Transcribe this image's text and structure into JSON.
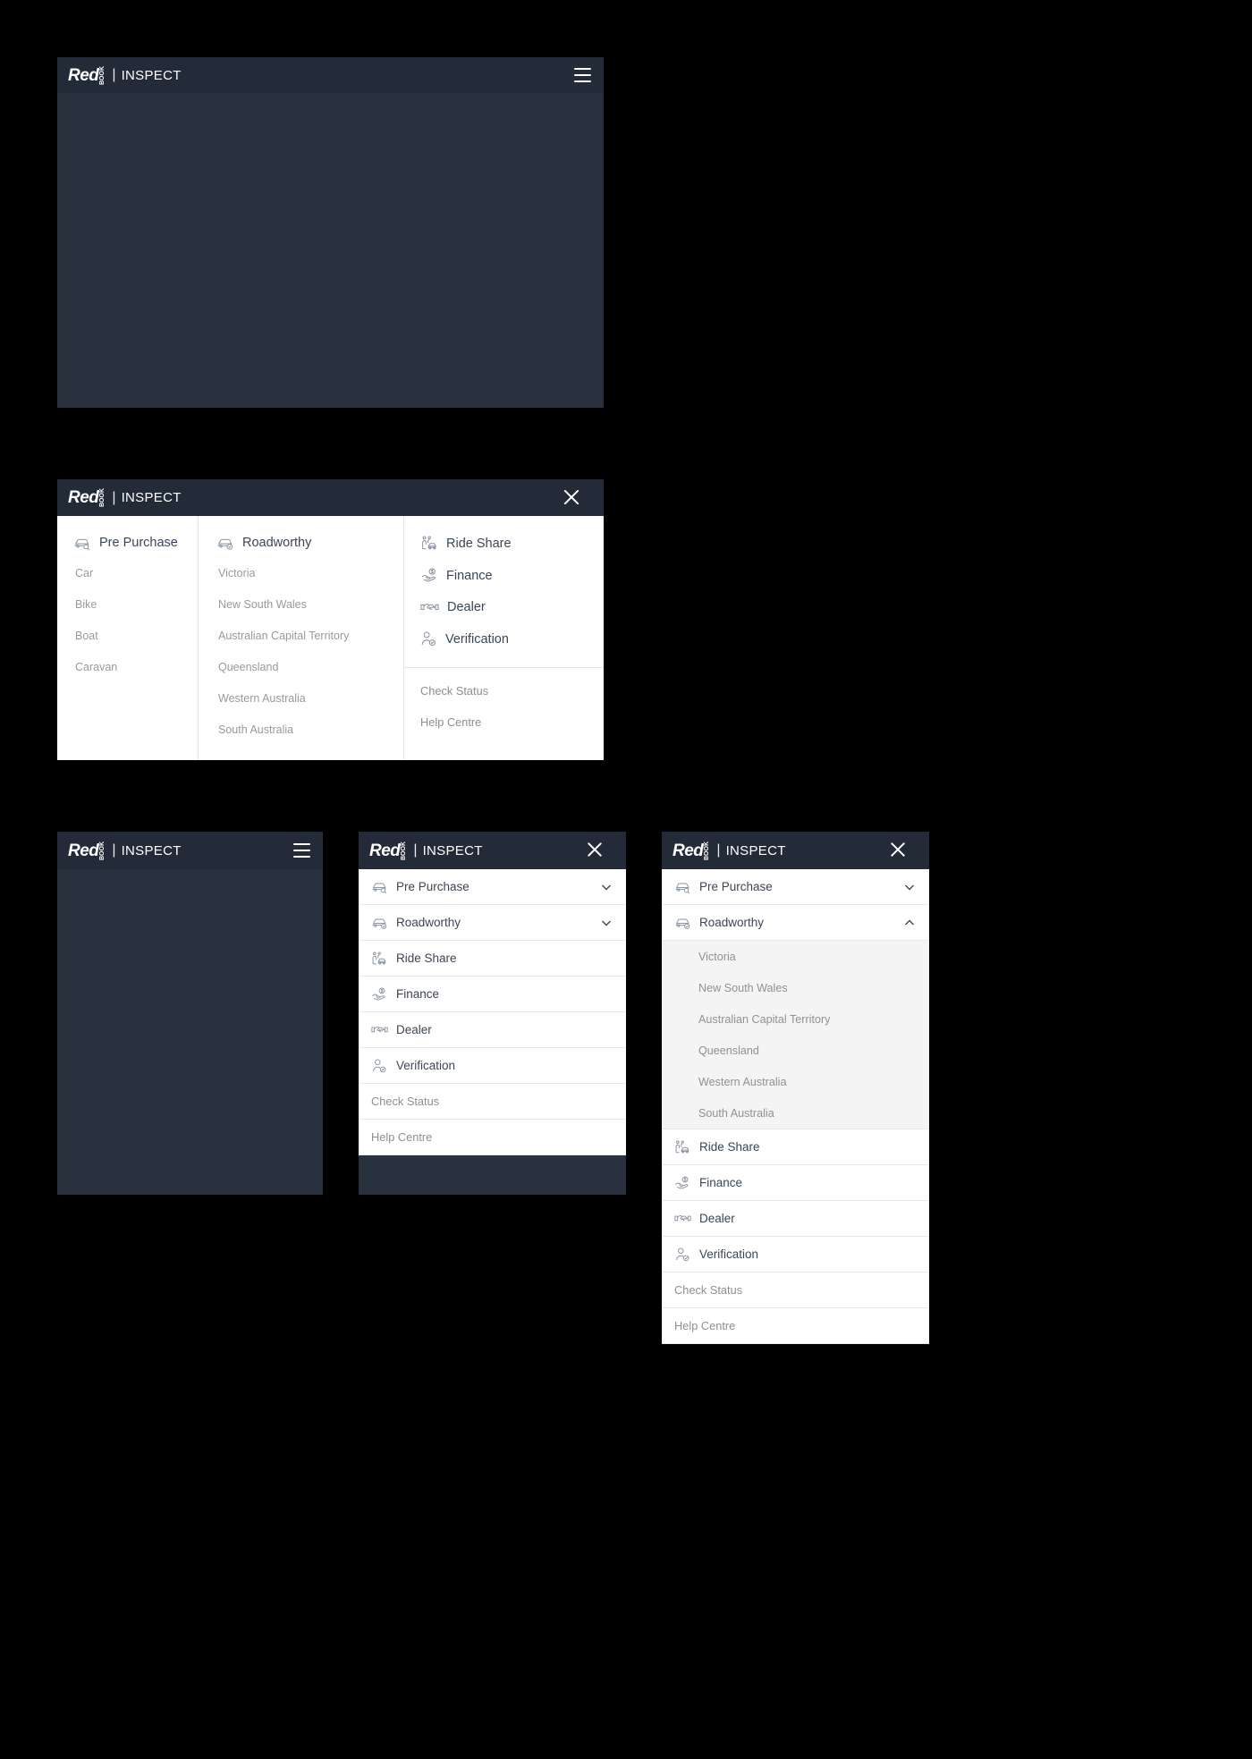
{
  "brand": {
    "red": "Red",
    "book": "BOOK",
    "separator": "|",
    "inspect": "INSPECT"
  },
  "colors": {
    "header_bg": "#242b38",
    "hero_bg": "#2a313e",
    "panel_bg": "#ffffff",
    "submenu_bg": "#f4f4f4",
    "primary_text": "#3b4559",
    "muted_text": "#9a9a9a",
    "divider": "#e6e6e6",
    "page_bg": "#000000"
  },
  "icons": {
    "hamburger": "hamburger-icon",
    "close": "close-icon",
    "chevron_down": "chevron-down-icon",
    "chevron_up": "chevron-up-icon",
    "pre_purchase": "car-inspect-icon",
    "roadworthy": "car-check-icon",
    "ride_share": "person-car-icon",
    "finance": "hand-dollar-icon",
    "dealer": "handshake-icon",
    "verification": "person-check-icon"
  },
  "mega_menu": {
    "columns": [
      {
        "name": "pre-purchase",
        "header": {
          "label": "Pre Purchase",
          "icon": "car-inspect-icon"
        },
        "items": [
          "Car",
          "Bike",
          "Boat",
          "Caravan"
        ]
      },
      {
        "name": "roadworthy",
        "header": {
          "label": "Roadworthy",
          "icon": "car-check-icon"
        },
        "items": [
          "Victoria",
          "New South Wales",
          "Australian Capital Territory",
          "Queensland",
          "Western Australia",
          "South Australia"
        ]
      },
      {
        "name": "services",
        "items": [
          {
            "label": "Ride Share",
            "icon": "person-car-icon"
          },
          {
            "label": "Finance",
            "icon": "hand-dollar-icon"
          },
          {
            "label": "Dealer",
            "icon": "handshake-icon"
          },
          {
            "label": "Verification",
            "icon": "person-check-icon"
          }
        ],
        "footer_links": [
          "Check Status",
          "Help Centre"
        ]
      }
    ]
  },
  "mobile_menu": {
    "rows": [
      {
        "label": "Pre Purchase",
        "icon": "car-inspect-icon",
        "chevron": "chevron-down-icon",
        "expandable": true
      },
      {
        "label": "Roadworthy",
        "icon": "car-check-icon",
        "chevron": "chevron-down-icon",
        "expandable": true
      },
      {
        "label": "Ride Share",
        "icon": "person-car-icon",
        "expandable": false
      },
      {
        "label": "Finance",
        "icon": "hand-dollar-icon",
        "expandable": false
      },
      {
        "label": "Dealer",
        "icon": "handshake-icon",
        "expandable": false
      },
      {
        "label": "Verification",
        "icon": "person-check-icon",
        "expandable": false
      }
    ],
    "plain_rows": [
      "Check Status",
      "Help Centre"
    ]
  },
  "mobile_menu_expanded": {
    "rows": [
      {
        "label": "Pre Purchase",
        "icon": "car-inspect-icon",
        "chevron": "chevron-down-icon",
        "expanded": false
      },
      {
        "label": "Roadworthy",
        "icon": "car-check-icon",
        "chevron": "chevron-up-icon",
        "expanded": true
      }
    ],
    "roadworthy_states": [
      "Victoria",
      "New South Wales",
      "Australian Capital Territory",
      "Queensland",
      "Western Australia",
      "South Australia"
    ],
    "service_rows": [
      {
        "label": "Ride Share",
        "icon": "person-car-icon"
      },
      {
        "label": "Finance",
        "icon": "hand-dollar-icon"
      },
      {
        "label": "Dealer",
        "icon": "handshake-icon"
      },
      {
        "label": "Verification",
        "icon": "person-check-icon"
      }
    ],
    "plain_rows": [
      "Check Status",
      "Help Centre"
    ]
  }
}
